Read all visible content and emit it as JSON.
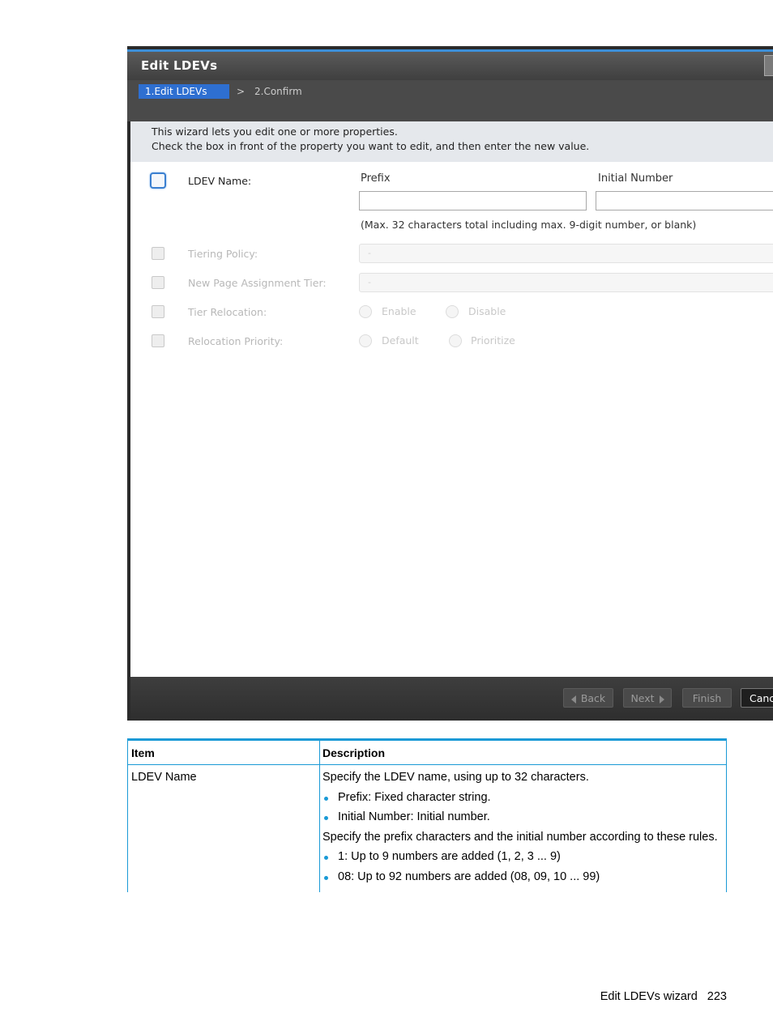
{
  "wizard": {
    "title": "Edit LDEVs",
    "steps": {
      "step1": "1.Edit LDEVs",
      "separator": ">",
      "step2": "2.Confirm"
    },
    "intro": [
      "This wizard lets you edit one or more properties.",
      "Check the  box in front of the property you want to edit, and then enter the new value."
    ],
    "ldev_name": {
      "label": "LDEV Name:",
      "prefix_header": "Prefix",
      "initial_number_header": "Initial Number",
      "prefix_value": "",
      "initial_number_value": "",
      "hint": "(Max. 32 characters total including max. 9-digit number, or blank)"
    },
    "tiering_policy": {
      "label": "Tiering Policy:",
      "value": "-"
    },
    "new_page_assignment_tier": {
      "label": "New Page Assignment Tier:",
      "value": "-"
    },
    "tier_relocation": {
      "label": "Tier Relocation:",
      "options": [
        "Enable",
        "Disable"
      ]
    },
    "relocation_priority": {
      "label": "Relocation Priority:",
      "options": [
        "Default",
        "Prioritize"
      ]
    },
    "buttons": {
      "back": "Back",
      "next": "Next",
      "finish": "Finish",
      "cancel": "Cancel"
    }
  },
  "table": {
    "headers": {
      "item": "Item",
      "description": "Description"
    },
    "row": {
      "item": "LDEV Name",
      "lines": [
        "Specify the LDEV name, using up to 32 characters.",
        "Prefix: Fixed character string.",
        "Initial Number: Initial number.",
        "Specify the prefix characters and the initial number according to these rules.",
        "1: Up to 9 numbers are added (1, 2, 3 ... 9)",
        "08: Up to 92 numbers are added (08, 09, 10 ... 99)"
      ]
    }
  },
  "footer": {
    "section": "Edit LDEVs wizard",
    "page": "223"
  }
}
